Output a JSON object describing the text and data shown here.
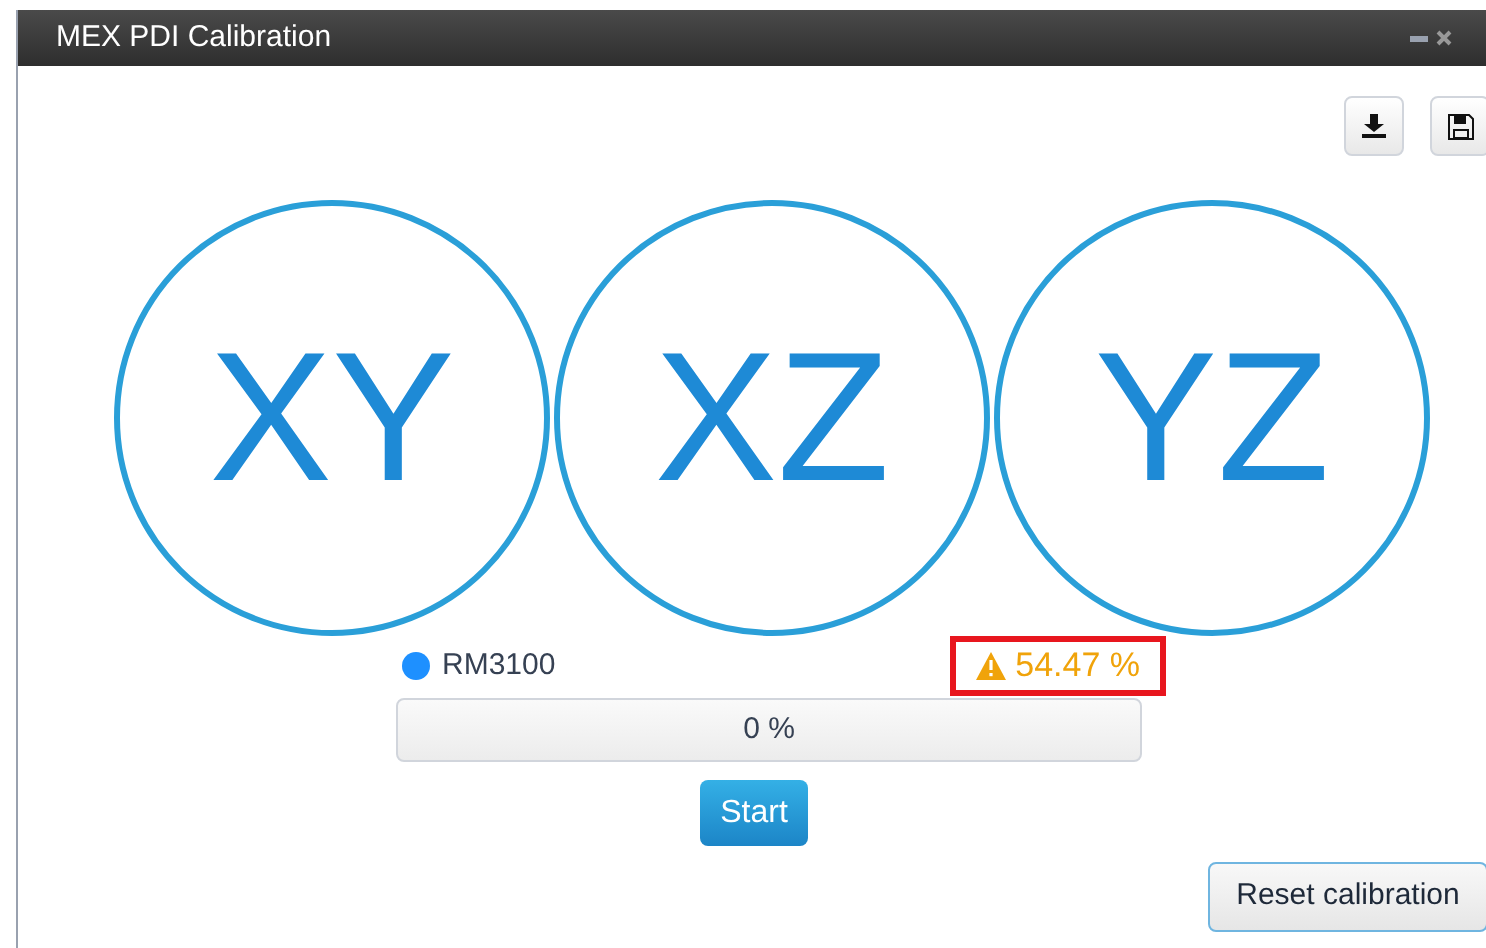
{
  "window": {
    "title": "MEX PDI Calibration"
  },
  "planes": [
    {
      "label": "XY"
    },
    {
      "label": "XZ"
    },
    {
      "label": "YZ"
    }
  ],
  "sensor": {
    "name": "RM3100",
    "color": "#1e90ff"
  },
  "warning": {
    "text": "54.47 %",
    "highlighted": true
  },
  "progress": {
    "level": 0,
    "reading": "0 %"
  },
  "buttons": {
    "start": "Start",
    "reset": "Reset calibration"
  }
}
